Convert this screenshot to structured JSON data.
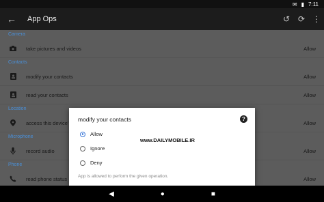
{
  "status": {
    "time": "7:11"
  },
  "appbar": {
    "title": "App Ops"
  },
  "sections": [
    {
      "header": "Camera",
      "rows": [
        {
          "icon": "camera-icon",
          "label": "take pictures and videos",
          "value": "Allow"
        }
      ]
    },
    {
      "header": "Contacts",
      "rows": [
        {
          "icon": "contacts-icon",
          "label": "modify your contacts",
          "value": "Allow"
        },
        {
          "icon": "contacts-icon",
          "label": "read your contacts",
          "value": "Allow"
        }
      ]
    },
    {
      "header": "Location",
      "rows": [
        {
          "icon": "location-pin-icon",
          "label": "access this device'",
          "value": "Allow"
        }
      ]
    },
    {
      "header": "Microphone",
      "rows": [
        {
          "icon": "microphone-icon",
          "label": "record audio",
          "value": "Allow"
        }
      ]
    },
    {
      "header": "Phone",
      "rows": [
        {
          "icon": "phone-icon",
          "label": "read phone status",
          "value": "Allow"
        }
      ]
    }
  ],
  "dialog": {
    "title": "modify your contacts",
    "watermark": "www.DAILYMOBILE.IR",
    "options": [
      "Allow",
      "Ignore",
      "Deny"
    ],
    "selected": "Allow",
    "note": "App is allowed to perform the given operation."
  }
}
